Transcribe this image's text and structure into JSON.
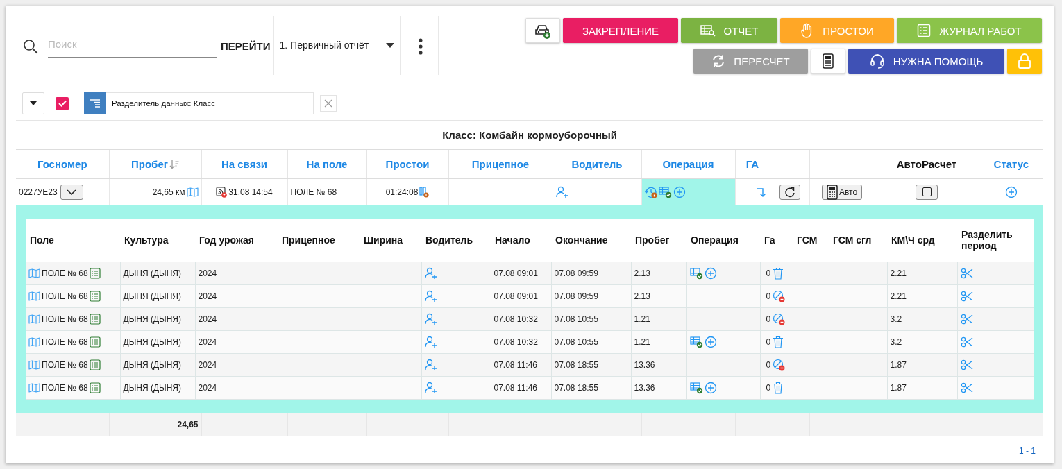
{
  "search": {
    "placeholder": "Поиск"
  },
  "goto_label": "ПЕРЕЙТИ",
  "report_select": {
    "value": "1. Первичный отчёт"
  },
  "toolbar": {
    "row_1": [
      {
        "kind": "icon"
      },
      {
        "kind": "label",
        "label": "ЗАКРЕПЛЕНИЕ",
        "color": "#e91e63"
      },
      {
        "kind": "label",
        "label": "ОТЧЕТ",
        "color": "#7cb342"
      },
      {
        "kind": "label",
        "label": "ПРОСТОИ",
        "color": "#ffa726"
      },
      {
        "kind": "label",
        "label": "ЖУРНАЛ РАБОТ",
        "color": "#8bc34a"
      }
    ],
    "row_2": [
      {
        "kind": "label",
        "label": "ПЕРЕСЧЕТ",
        "color": "#9e9e9e"
      },
      {
        "kind": "icon"
      },
      {
        "kind": "label",
        "label": "НУЖНА ПОМОЩЬ",
        "color": "#3f51b5"
      },
      {
        "kind": "icon",
        "color": "#ffc107"
      }
    ]
  },
  "filter": {
    "checkbox": {
      "checked": true
    },
    "chip": {
      "label": "Разделитель данных: Класс"
    }
  },
  "grid": {
    "group_label": "Класс: Комбайн кормоуборочный",
    "columns": [
      {
        "label": "Госномер",
        "clickable": true
      },
      {
        "label": "Пробег",
        "clickable": true,
        "sorted": true
      },
      {
        "label": "На связи",
        "clickable": true
      },
      {
        "label": "На поле",
        "clickable": true
      },
      {
        "label": "Простои",
        "clickable": true
      },
      {
        "label": "Прицепное",
        "clickable": true
      },
      {
        "label": "Водитель",
        "clickable": true
      },
      {
        "label": "Операция",
        "clickable": true
      },
      {
        "label": "ГА",
        "clickable": true
      },
      {},
      {},
      {
        "label": "АвтоРасчет",
        "clickable": false
      },
      {
        "label": "Статус",
        "clickable": true
      }
    ],
    "rows": [
      {
        "plate": "0227УЕ23",
        "expanded": true,
        "mileage": "24,65 км",
        "online": "31.08 14:54",
        "field": "ПОЛЕ № 68",
        "idle": "01:24:08",
        "auto_label": "Авто",
        "auto_calc": false,
        "details": {
          "columns": [
            "Поле",
            "Культура",
            "Год урожая",
            "Прицепное",
            "Ширина",
            "Водитель",
            "Начало",
            "Окончание",
            "Пробег",
            "Операция",
            "Га",
            "ГСМ",
            "ГСМ сгл",
            "КМ\\Ч срд",
            "Разделить период"
          ],
          "rows": [
            {
              "field": "ПОЛЕ № 68",
              "crop": "ДЫНЯ (ДЫНЯ)",
              "year": "2024",
              "start": "07.08 09:01",
              "end": "07.08 09:59",
              "mileage": "2.13",
              "has_operation": true,
              "ga": "0",
              "deletable": true,
              "speed": "2.21"
            },
            {
              "field": "ПОЛЕ № 68",
              "crop": "ДЫНЯ (ДЫНЯ)",
              "year": "2024",
              "start": "07.08 09:01",
              "end": "07.08 09:59",
              "mileage": "2.13",
              "has_operation": false,
              "ga": "0",
              "deletable": false,
              "speed": "2.21"
            },
            {
              "field": "ПОЛЕ № 68",
              "crop": "ДЫНЯ (ДЫНЯ)",
              "year": "2024",
              "start": "07.08 10:32",
              "end": "07.08 10:55",
              "mileage": "1.21",
              "has_operation": false,
              "ga": "0",
              "deletable": false,
              "speed": "3.2"
            },
            {
              "field": "ПОЛЕ № 68",
              "crop": "ДЫНЯ (ДЫНЯ)",
              "year": "2024",
              "start": "07.08 10:32",
              "end": "07.08 10:55",
              "mileage": "1.21",
              "has_operation": true,
              "ga": "0",
              "deletable": true,
              "speed": "3.2"
            },
            {
              "field": "ПОЛЕ № 68",
              "crop": "ДЫНЯ (ДЫНЯ)",
              "year": "2024",
              "start": "07.08 11:46",
              "end": "07.08 18:55",
              "mileage": "13.36",
              "has_operation": false,
              "ga": "0",
              "deletable": false,
              "speed": "1.87"
            },
            {
              "field": "ПОЛЕ № 68",
              "crop": "ДЫНЯ (ДЫНЯ)",
              "year": "2024",
              "start": "07.08 11:46",
              "end": "07.08 18:55",
              "mileage": "13.36",
              "has_operation": true,
              "ga": "0",
              "deletable": true,
              "speed": "1.87"
            }
          ]
        }
      }
    ],
    "footer": {
      "mileage_total": "24,65"
    }
  },
  "pagination": "1 - 1"
}
